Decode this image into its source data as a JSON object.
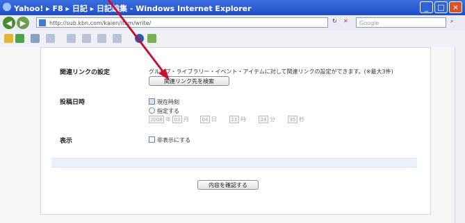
{
  "window": {
    "title": "Yahoo! ▸ F8 ▸ 日記 ▸ 日記編集 - Windows Internet Explorer",
    "buttons": [
      "_",
      "□",
      "×"
    ]
  },
  "nav": {
    "back": "◀",
    "forward": "▶",
    "address": "http://sub.kbn.com/kaien/item/write/",
    "refresh": "↻",
    "stop": "✕",
    "search_placeholder": "Google",
    "search_btn": "⌕"
  },
  "form": {
    "related_label": "関連リンクの設定",
    "related_desc": "グループ・ライブラリー・イベント・アイテムに対して関連リンクの設定ができます。(※最大3件)",
    "related_button": "関連リンク先を検索",
    "datetime_label": "投稿日時",
    "opt_now": "現在時刻",
    "opt_specify": "指定する",
    "date_fields": [
      "2008",
      "年",
      "03",
      "月",
      "04",
      "日",
      "11",
      "時",
      "24",
      "分",
      "35",
      "秒"
    ],
    "display_label": "表示",
    "hide_option": "非表示にする",
    "confirm_button": "内容を確認する"
  }
}
